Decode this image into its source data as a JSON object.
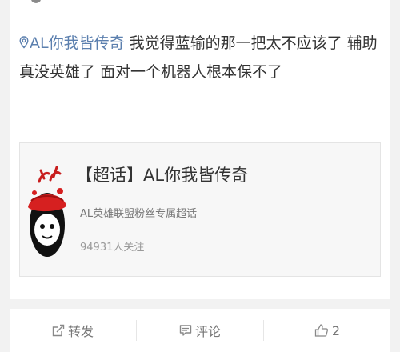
{
  "post": {
    "topic_tag": "AL你我皆传奇",
    "body_text": " 我觉得蓝输的那一把太不应该了 辅助真没英雄了 面对一个机器人根本保不了"
  },
  "share_card": {
    "title": "【超话】AL你我皆传奇",
    "description": "AL英雄联盟粉丝专属超话",
    "followers": "94931人关注"
  },
  "actions": {
    "repost_label": "转发",
    "comment_label": "评论",
    "like_count": "2"
  },
  "icons": {
    "location": "location-pin-icon",
    "repost": "repost-icon",
    "comment": "comment-icon",
    "like": "thumbs-up-icon"
  },
  "colors": {
    "link": "#5b7fae",
    "text": "#333333",
    "muted": "#777777"
  }
}
